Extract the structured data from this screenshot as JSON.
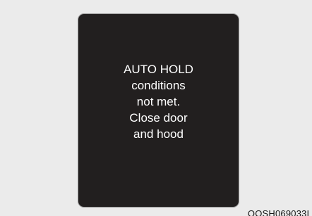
{
  "display": {
    "message_lines": [
      "AUTO HOLD",
      "conditions",
      "not met.",
      "Close door",
      "and hood"
    ]
  },
  "figure_code": "OOSH069033L",
  "colors": {
    "background": "#ebebeb",
    "display_background": "#221f1f",
    "display_text": "#ffffff"
  }
}
